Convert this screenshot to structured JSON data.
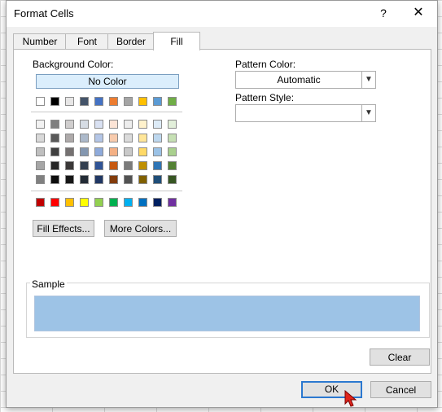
{
  "dialog": {
    "title": "Format Cells",
    "help_symbol": "?",
    "close_symbol": "✕"
  },
  "tabs": [
    {
      "label": "Number"
    },
    {
      "label": "Font"
    },
    {
      "label": "Border"
    },
    {
      "label": "Fill",
      "active": true
    }
  ],
  "fill": {
    "background_color_label": "Background Color:",
    "no_color_label": "No Color",
    "theme_colors": [
      "#ffffff",
      "#000000",
      "#e7e6e6",
      "#44546a",
      "#4472c4",
      "#ed7d31",
      "#a5a5a5",
      "#ffc000",
      "#5b9bd5",
      "#70ad47"
    ],
    "tints": [
      [
        "#f2f2f2",
        "#7f7f7f",
        "#d0cece",
        "#d6dce4",
        "#d9e1f2",
        "#fce4d6",
        "#ededed",
        "#fff2cc",
        "#ddebf7",
        "#e2efda"
      ],
      [
        "#d9d9d9",
        "#595959",
        "#aeaaaa",
        "#acb9ca",
        "#b4c6e7",
        "#f8cbad",
        "#dbdbdb",
        "#ffe699",
        "#bdd7ee",
        "#c6e0b4"
      ],
      [
        "#bfbfbf",
        "#404040",
        "#757171",
        "#8497b0",
        "#8eaadb",
        "#f4b084",
        "#c9c9c9",
        "#ffd966",
        "#9bc2e6",
        "#a9d08e"
      ],
      [
        "#a6a6a6",
        "#262626",
        "#3a3838",
        "#333f4f",
        "#305496",
        "#c65911",
        "#7b7b7b",
        "#bf8f00",
        "#2f75b5",
        "#548235"
      ],
      [
        "#808080",
        "#0d0d0d",
        "#161616",
        "#222b35",
        "#203764",
        "#833c0c",
        "#525252",
        "#806000",
        "#1f4e78",
        "#375623"
      ]
    ],
    "standard_colors": [
      "#c00000",
      "#ff0000",
      "#ffc000",
      "#ffff00",
      "#92d050",
      "#00b050",
      "#00b0f0",
      "#0070c0",
      "#002060",
      "#7030a0"
    ],
    "selected_color": "#9dc3e6",
    "fill_effects_label": "Fill Effects...",
    "more_colors_label": "More Colors...",
    "pattern_color_label": "Pattern Color:",
    "pattern_color_value": "Automatic",
    "pattern_style_label": "Pattern Style:",
    "pattern_style_value": "",
    "sample_label": "Sample",
    "sample_color": "#9dc3e6",
    "clear_label": "Clear"
  },
  "buttons": {
    "ok_label": "OK",
    "cancel_label": "Cancel"
  }
}
